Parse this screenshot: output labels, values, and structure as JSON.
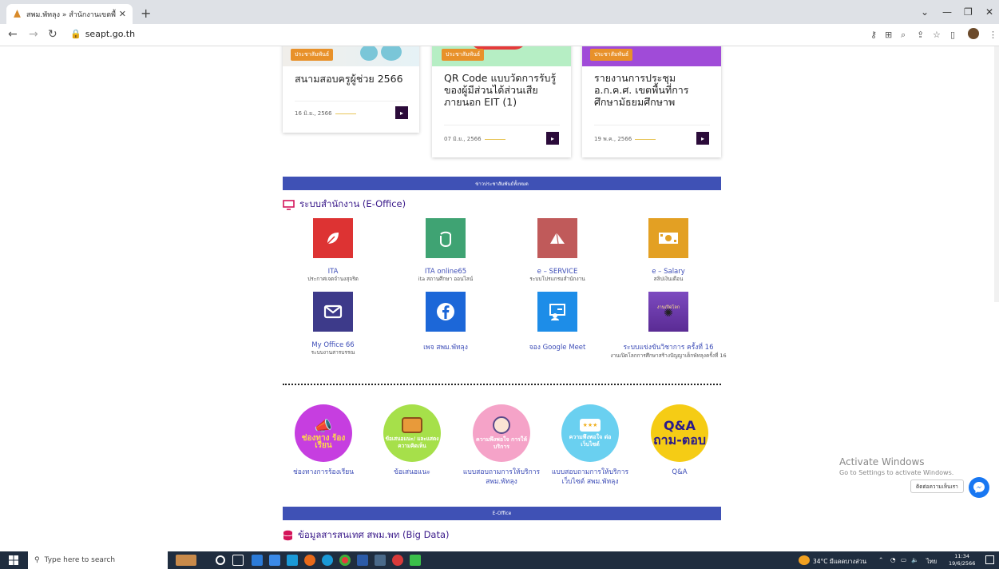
{
  "browser": {
    "tab_title": "สพม.พัทลุง » สำนักงานเขตพื้นที่การศึ",
    "tab_close": "✕",
    "new_tab": "+",
    "url": "seapt.go.th"
  },
  "cards": [
    {
      "badge": "ประชาสัมพันธ์",
      "title": "สนามสอบครูผู้ช่วย 2566",
      "date": "16 มิ.ย., 2566"
    },
    {
      "badge": "ประชาสัมพันธ์",
      "title": "QR Code แบบวัดการรับรู้ของผู้มีส่วนได้ส่วนเสียภายนอก EIT (1)",
      "date": "07 มิ.ย., 2566"
    },
    {
      "badge": "ประชาสัมพันธ์",
      "title": "รายงานการประชุม อ.ก.ค.ศ. เขตพื้นที่การศึกษามัธยมศึกษาพ",
      "date": "19 พ.ค., 2566"
    }
  ],
  "all_news_bar": "ข่าวประชาสัมพันธ์ทั้งหมด",
  "eoffice": {
    "heading": "ระบบสำนักงาน (E-Office)",
    "items": [
      {
        "title": "ITA",
        "sub": "ประกาศเจตจำนงสุจริต",
        "color": "#dd3333",
        "icon": "leaf-icon"
      },
      {
        "title": "ITA online65",
        "sub": "ita สถานศึกษา ออนไลน์",
        "color": "#3fa373",
        "icon": "hand-icon"
      },
      {
        "title": "e – SERVICE",
        "sub": "ระบบโปรแกรมสำนักงาน",
        "color": "#c05a5a",
        "icon": "paper-plane-icon"
      },
      {
        "title": "e – Salary",
        "sub": "สลิปเงินเดือน",
        "color": "#e3a023",
        "icon": "money-icon"
      },
      {
        "title": "My Office 66",
        "sub": "ระบบงานสารบรรณ",
        "color": "#3d3a8a",
        "icon": "mail-icon"
      },
      {
        "title": "เพจ สพม.พัทลุง",
        "sub": "",
        "color": "#1c67d8",
        "icon": "facebook-icon"
      },
      {
        "title": "จอง Google Meet",
        "sub": "",
        "color": "#1d8de8",
        "icon": "meeting-icon"
      },
      {
        "title": "ระบบแข่งขันวิชาการ ครั้งที่ 16",
        "sub": "งานเปิดโลกการศึกษาสร้างปัญญาเด็กพัทลุงครั้งที่ 16",
        "color": "#6a3aa8",
        "icon": "contest-icon",
        "tile_text": "งานเปิดโลก"
      }
    ]
  },
  "services": [
    {
      "title": "ช่องทางการร้องเรียน",
      "circle_text": "ช่องทาง ร้องเรียน",
      "color": "#c63ee0",
      "icon": "megaphone-icon"
    },
    {
      "title": "ข้อเสนอแนะ",
      "circle_text": "ข้อเสนอแนะ/ และแสดงความคิดเห็น",
      "color": "#a6e04a",
      "icon": "chat-icon"
    },
    {
      "title": "แบบสอบถามการให้บริการ สพม.พัทลุง",
      "circle_text": "ความพึงพอใจ การให้บริการ",
      "color": "#f5a3c8",
      "icon": "person-icon"
    },
    {
      "title": "แบบสอบถามการให้บริการเว็บไซต์ สพม.พัทลุง",
      "circle_text": "ความพึงพอใจ ต่อเว็บไซต์",
      "color": "#6ad0f0",
      "icon": "rating-icon"
    },
    {
      "title": "Q&A",
      "circle_text": "Q&A ถาม-ตอบ",
      "color": "#f5cc15",
      "icon": "qa-icon"
    }
  ],
  "eoffice_bar": "E-Office",
  "bigdata_heading": "ข้อมูลสารสนเทศ สพม.พท (Big Data)",
  "activate": {
    "line1": "Activate Windows",
    "line2": "Go to Settings to activate Windows."
  },
  "chat_button": "ติดต่อความเห็นเรา",
  "taskbar": {
    "search_placeholder": "Type here to search",
    "weather": "34°C มีแดดบางส่วน",
    "lang": "ไทย",
    "time": "11:34",
    "date": "19/6/2566"
  },
  "colors": {
    "accent": "#3f51b5",
    "heading": "#3a1a8a",
    "link": "#3d4db7",
    "badge": "#e8912a"
  }
}
